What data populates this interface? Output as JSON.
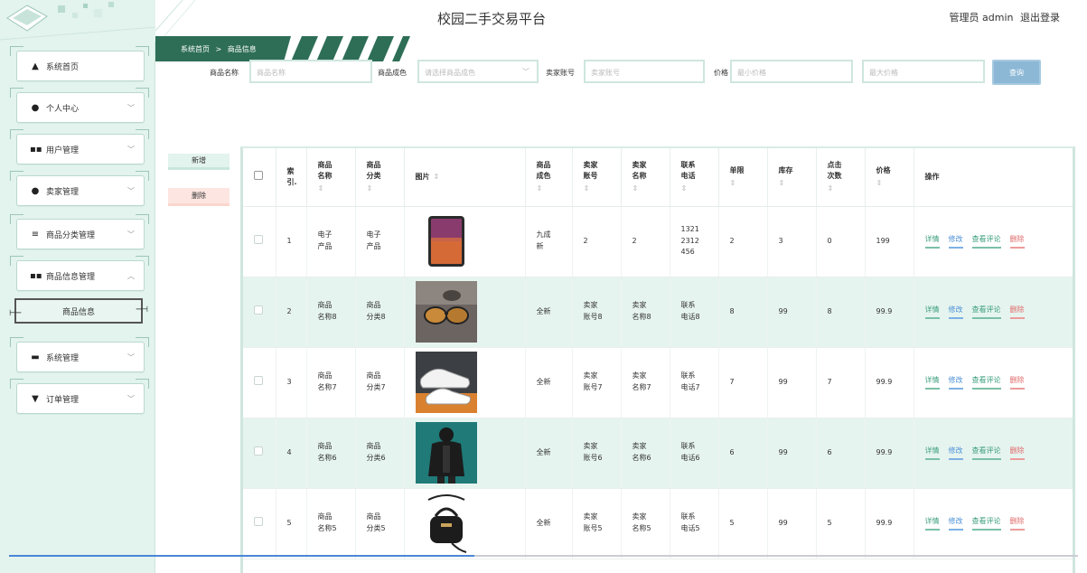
{
  "header": {
    "title": "校园二手交易平台",
    "admin_label": "管理员 admin",
    "logout_label": "退出登录"
  },
  "breadcrumb": {
    "home": "系统首页",
    "separator": ">",
    "current": "商品信息"
  },
  "sidebar": {
    "items": [
      {
        "label": "系统首页",
        "icon": "home-icon"
      },
      {
        "label": "个人中心",
        "icon": "person-icon"
      },
      {
        "label": "用户管理",
        "icon": "grid-icon"
      },
      {
        "label": "卖家管理",
        "icon": "person-icon"
      },
      {
        "label": "商品分类管理",
        "icon": "list-icon"
      },
      {
        "label": "商品信息管理",
        "icon": "grid-icon"
      },
      {
        "label": "系统管理",
        "icon": "monitor-icon"
      },
      {
        "label": "订单管理",
        "icon": "pin-icon"
      }
    ],
    "submenu_label": "商品信息"
  },
  "search": {
    "name_label": "商品名称",
    "name_placeholder": "商品名称",
    "condition_label": "商品成色",
    "condition_placeholder": "请选择商品成色",
    "seller_label": "卖家账号",
    "seller_placeholder": "卖家账号",
    "price_label": "价格",
    "min_price_placeholder": "最小价格",
    "max_price_placeholder": "最大价格",
    "search_button": "查询"
  },
  "actions": {
    "add_label": "新增",
    "delete_label": "删除"
  },
  "table": {
    "headers": {
      "index_l1": "索",
      "index_l2": "引.",
      "name_l1": "商品",
      "name_l2": "名称",
      "category_l1": "商品",
      "category_l2": "分类",
      "image": "图片",
      "condition_l1": "商品",
      "condition_l2": "成色",
      "seller_account_l1": "卖家",
      "seller_account_l2": "账号",
      "seller_name_l1": "卖家",
      "seller_name_l2": "名称",
      "phone_l1": "联系",
      "phone_l2": "电话",
      "limit": "单限",
      "stock": "库存",
      "clicks_l1": "点击",
      "clicks_l2": "次数",
      "price": "价格",
      "ops": "操作",
      "sort_glyph": "⇕"
    },
    "row_actions": {
      "detail": "详情",
      "edit": "修改",
      "comments": "查看评论",
      "delete": "删除"
    },
    "rows": [
      {
        "index": "1",
        "name_l1": "电子",
        "name_l2": "产品",
        "cat_l1": "电子",
        "cat_l2": "产品",
        "image": "tablet",
        "cond_l1": "九成",
        "cond_l2": "新",
        "acc_l1": "2",
        "acc_l2": "",
        "sname_l1": "2",
        "sname_l2": "",
        "phone_l1": "1321",
        "phone_l2": "2312",
        "phone_l3": "456",
        "limit": "2",
        "stock": "3",
        "clicks": "0",
        "price": "199"
      },
      {
        "index": "2",
        "name_l1": "商品",
        "name_l2": "名称8",
        "cat_l1": "商品",
        "cat_l2": "分类8",
        "image": "sunglasses",
        "cond_l1": "全新",
        "cond_l2": "",
        "acc_l1": "卖家",
        "acc_l2": "账号8",
        "sname_l1": "卖家",
        "sname_l2": "名称8",
        "phone_l1": "联系",
        "phone_l2": "电话8",
        "phone_l3": "",
        "limit": "8",
        "stock": "99",
        "clicks": "8",
        "price": "99.9"
      },
      {
        "index": "3",
        "name_l1": "商品",
        "name_l2": "名称7",
        "cat_l1": "商品",
        "cat_l2": "分类7",
        "image": "sneakers",
        "cond_l1": "全新",
        "cond_l2": "",
        "acc_l1": "卖家",
        "acc_l2": "账号7",
        "sname_l1": "卖家",
        "sname_l2": "名称7",
        "phone_l1": "联系",
        "phone_l2": "电话7",
        "phone_l3": "",
        "limit": "7",
        "stock": "99",
        "clicks": "7",
        "price": "99.9"
      },
      {
        "index": "4",
        "name_l1": "商品",
        "name_l2": "名称6",
        "cat_l1": "商品",
        "cat_l2": "分类6",
        "image": "jacket",
        "cond_l1": "全新",
        "cond_l2": "",
        "acc_l1": "卖家",
        "acc_l2": "账号6",
        "sname_l1": "卖家",
        "sname_l2": "名称6",
        "phone_l1": "联系",
        "phone_l2": "电话6",
        "phone_l3": "",
        "limit": "6",
        "stock": "99",
        "clicks": "6",
        "price": "99.9"
      },
      {
        "index": "5",
        "name_l1": "商品",
        "name_l2": "名称5",
        "cat_l1": "商品",
        "cat_l2": "分类5",
        "image": "handbag",
        "cond_l1": "全新",
        "cond_l2": "",
        "acc_l1": "卖家",
        "acc_l2": "账号5",
        "sname_l1": "卖家",
        "sname_l2": "名称5",
        "phone_l1": "联系",
        "phone_l2": "电话5",
        "phone_l3": "",
        "limit": "5",
        "stock": "99",
        "clicks": "5",
        "price": "99.9"
      }
    ]
  },
  "colors": {
    "sidebar_bg": "#e3f3ee",
    "accent_green": "#3b9e7d",
    "accent_blue": "#4a8fd6",
    "danger": "#e06a6a",
    "row_alt": "#e6f4ef"
  }
}
